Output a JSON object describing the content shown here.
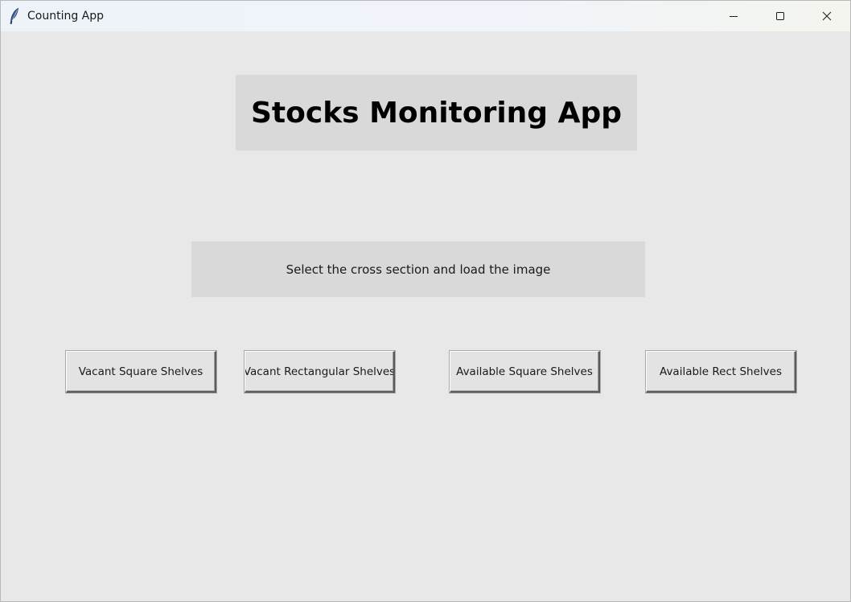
{
  "window": {
    "title": "Counting App"
  },
  "header": {
    "title": "Stocks Monitoring App"
  },
  "instruction": {
    "text": "Select the cross section and load the image"
  },
  "buttons": [
    {
      "label": "Vacant Square Shelves"
    },
    {
      "label": "Vacant Rectangular Shelves"
    },
    {
      "label": "Available Square Shelves"
    },
    {
      "label": "Available Rect Shelves"
    }
  ],
  "icons": {
    "app": "feather-icon",
    "minimize": "minimize-icon",
    "maximize": "maximize-icon",
    "close": "close-icon"
  },
  "colors": {
    "background": "#e8e8e8",
    "panel": "#d9d9d9",
    "titlebar": "#eef2f9"
  }
}
